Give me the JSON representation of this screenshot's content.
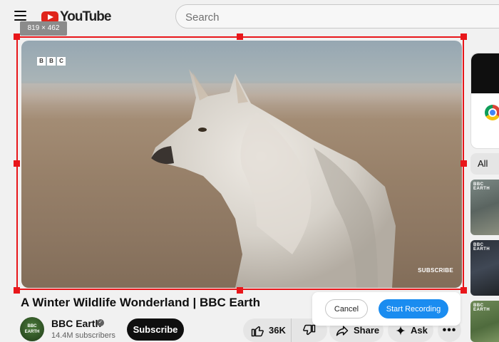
{
  "header": {
    "logo_text": "YouTube",
    "search_placeholder": "Search"
  },
  "selection": {
    "dimensions_label": "819 × 462"
  },
  "video": {
    "channel_watermark": [
      "B",
      "B",
      "C"
    ],
    "overlay_subscribe": "SUBSCRIBE",
    "title": "A Winter Wildlife Wonderland | BBC Earth"
  },
  "channel": {
    "avatar_text": "BBC EARTH",
    "name": "BBC Earth",
    "subscribers": "14.4M subscribers",
    "subscribe_label": "Subscribe"
  },
  "actions": {
    "likes": "36K",
    "share_label": "Share",
    "ask_label": "Ask"
  },
  "sidebar": {
    "chip_all": "All",
    "thumb_label": "BBC EARTH"
  },
  "recording_dialog": {
    "cancel_label": "Cancel",
    "start_label": "Start Recording"
  },
  "colors": {
    "selection": "#e8161a",
    "primary_button": "#1a8cf0",
    "youtube_red": "#e0241b"
  }
}
